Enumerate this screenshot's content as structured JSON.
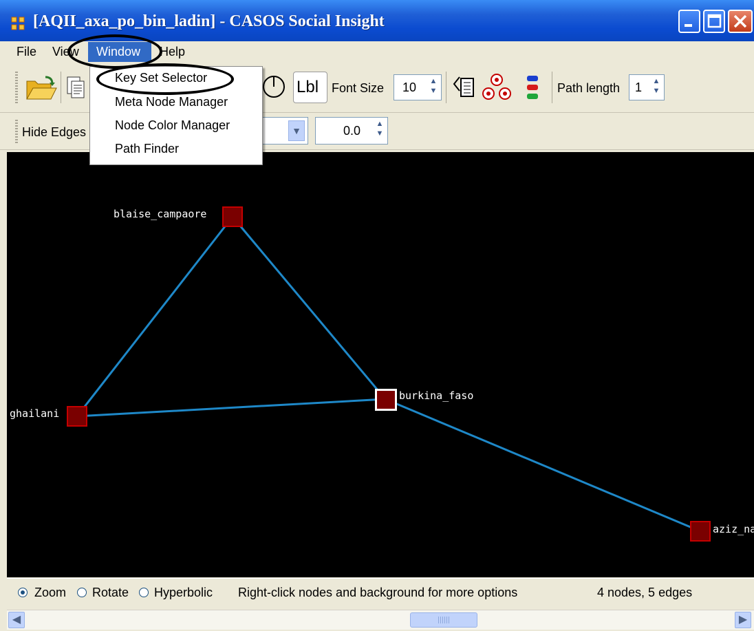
{
  "window": {
    "title": "[AQII_axa_po_bin_ladin] - CASOS Social Insight"
  },
  "menubar": {
    "file": "File",
    "view": "View",
    "window": "Window",
    "help": "Help"
  },
  "window_menu": {
    "items": [
      "Key Set Selector",
      "Meta Node Manager",
      "Node Color Manager",
      "Path Finder"
    ]
  },
  "toolbar1": {
    "label_button": "Lbl",
    "font_size_label": "Font Size",
    "font_size_value": "10",
    "path_length_label": "Path length",
    "path_length_value": "1"
  },
  "toolbar2": {
    "hide_edges_label": "Hide Edges",
    "threshold_value": "0.0"
  },
  "graph": {
    "nodes": [
      {
        "id": "blaise_campaore",
        "label": "blaise_campaore"
      },
      {
        "id": "ghailani",
        "label": "ghailani"
      },
      {
        "id": "burkina_faso",
        "label": "burkina_faso",
        "selected": true
      },
      {
        "id": "aziz_na",
        "label": "aziz_na"
      }
    ],
    "edges": [
      [
        "blaise_campaore",
        "ghailani"
      ],
      [
        "blaise_campaore",
        "burkina_faso"
      ],
      [
        "ghailani",
        "burkina_faso"
      ],
      [
        "burkina_faso",
        "aziz_na"
      ]
    ],
    "node_color": "#7a0000",
    "node_border": "#c40000",
    "edge_color": "#1e88c8",
    "background": "#000000"
  },
  "statusbar": {
    "zoom": "Zoom",
    "rotate": "Rotate",
    "hyperbolic": "Hyperbolic",
    "hint": "Right-click nodes and background for more options",
    "counts": "4 nodes, 5 edges"
  }
}
